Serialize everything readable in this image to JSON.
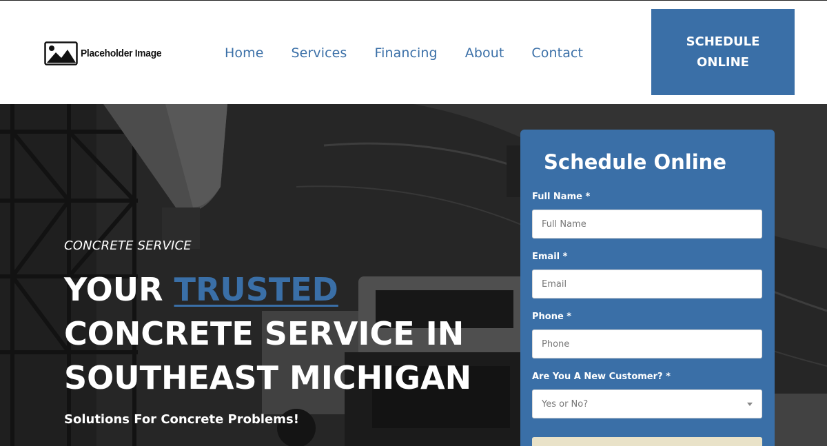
{
  "header": {
    "logo_text": "Placeholder Image",
    "nav": [
      "Home",
      "Services",
      "Financing",
      "About",
      "Contact"
    ],
    "schedule_button": "SCHEDULE ONLINE"
  },
  "hero": {
    "eyebrow": "CONCRETE SERVICE",
    "headline_prefix": "YOUR ",
    "headline_accent": "TRUSTED",
    "headline_line2": "CONCRETE SERVICE IN",
    "headline_line3": "SOUTHEAST MICHIGAN",
    "subheading": "Solutions For Concrete Problems!"
  },
  "form": {
    "title": "Schedule Online",
    "full_name_label": "Full Name *",
    "full_name_placeholder": "Full Name",
    "email_label": "Email *",
    "email_placeholder": "Email",
    "phone_label": "Phone *",
    "phone_placeholder": "Phone",
    "new_customer_label": "Are You A New Customer? *",
    "new_customer_placeholder": "Yes or No?"
  },
  "colors": {
    "brand_blue": "#3a6fa7",
    "submit_button": "#e9e2c8"
  }
}
